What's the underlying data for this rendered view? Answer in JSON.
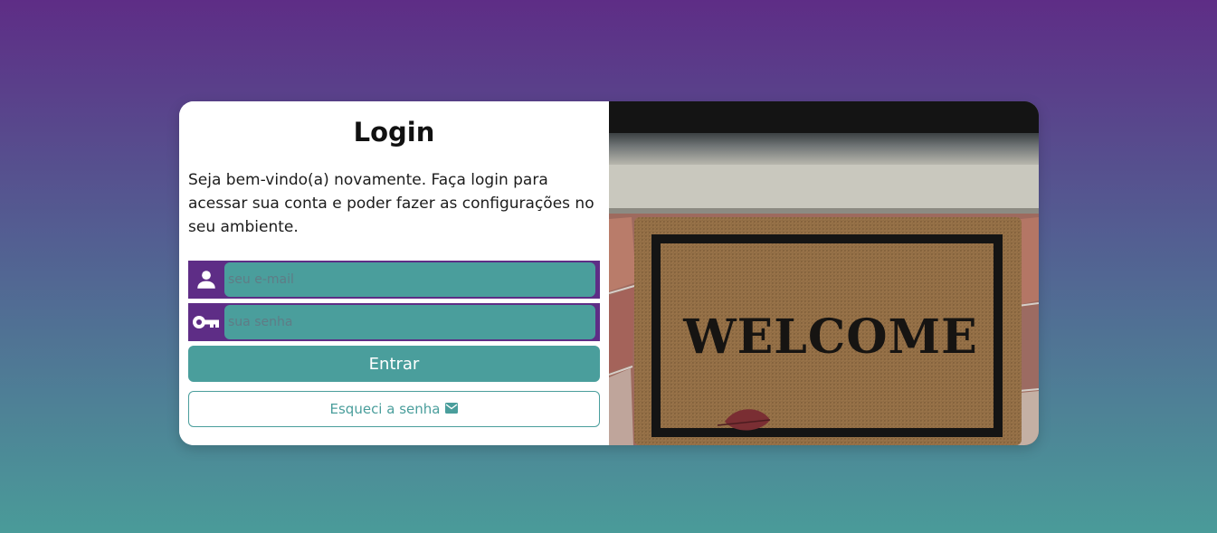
{
  "login": {
    "title": "Login",
    "description": "Seja bem-vindo(a) novamente. Faça login para acessar sua conta e poder fazer as configurações no seu ambiente.",
    "email_placeholder": "seu e-mail",
    "password_placeholder": "sua senha",
    "submit_label": "Entrar",
    "forgot_label": "Esqueci a senha"
  },
  "image": {
    "doormat_text": "WELCOME"
  },
  "icons": {
    "email_field": "user-icon",
    "password_field": "key-icon",
    "forgot_button": "envelope-icon"
  },
  "colors": {
    "primary_purple": "#5e2d86",
    "primary_teal": "#4a9e9c",
    "background_top": "#5e2d86",
    "background_bottom": "#4a9b99"
  }
}
